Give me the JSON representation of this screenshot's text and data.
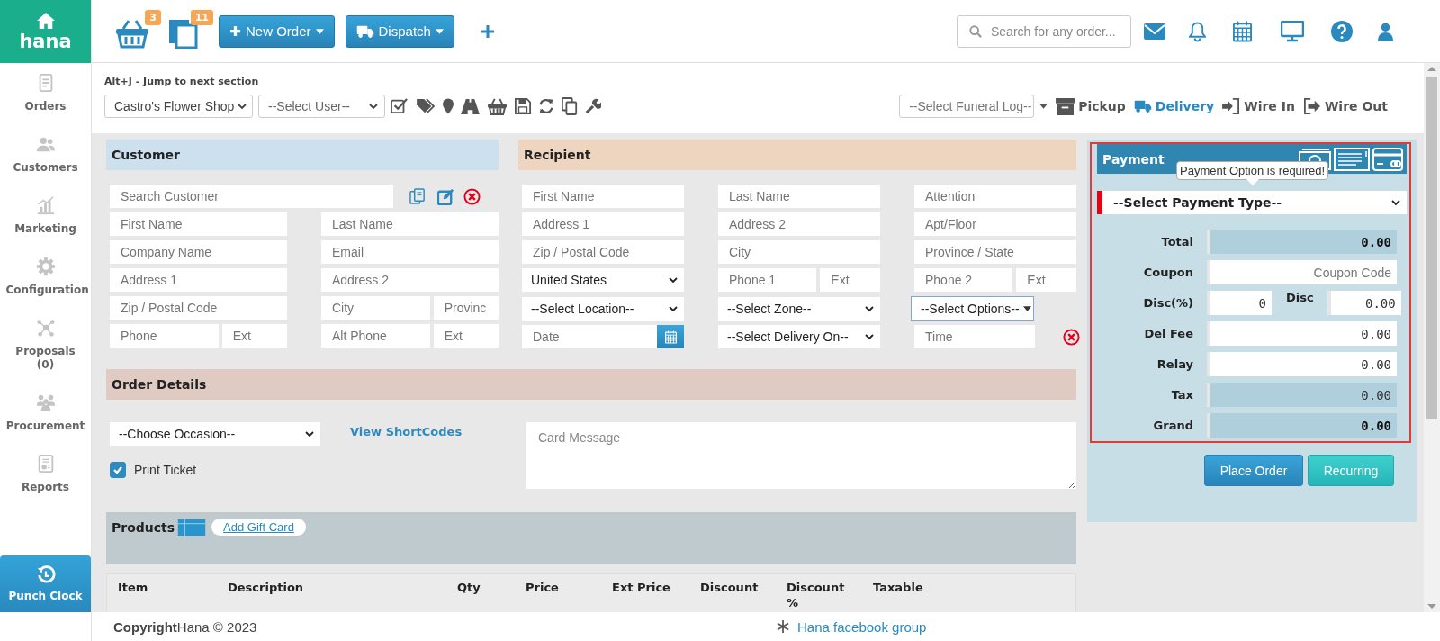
{
  "brand": {
    "name": "hana"
  },
  "sidebar": {
    "items": [
      {
        "kind": "orders",
        "label": "Orders"
      },
      {
        "kind": "customers",
        "label": "Customers"
      },
      {
        "kind": "marketing",
        "label": "Marketing"
      },
      {
        "kind": "configuration",
        "label": "Configuration"
      },
      {
        "kind": "proposals",
        "label": "Proposals (0)"
      },
      {
        "kind": "procurement",
        "label": "Procurement"
      },
      {
        "kind": "reports",
        "label": "Reports"
      }
    ],
    "punch_clock": {
      "label": "Punch Clock"
    }
  },
  "topbar": {
    "counters": [
      {
        "kind": "basket",
        "count": "3"
      },
      {
        "kind": "copies",
        "count": "11"
      }
    ],
    "buttons": [
      {
        "kind": "new_order",
        "label": "New Order"
      },
      {
        "kind": "dispatch",
        "label": "Dispatch"
      }
    ],
    "search": {
      "placeholder": "Search for any order..."
    }
  },
  "hint": "Alt+J - Jump to next section",
  "toolbar": {
    "shop": "Castro's Flower Shop",
    "user": "--Select User--",
    "funeral_log": "--Select Funeral Log--",
    "order_types": [
      {
        "kind": "pickup",
        "label": "Pickup",
        "selected": false
      },
      {
        "kind": "delivery",
        "label": "Delivery",
        "selected": true
      },
      {
        "kind": "wire_in",
        "label": "Wire In",
        "selected": false
      },
      {
        "kind": "wire_out",
        "label": "Wire Out",
        "selected": false
      }
    ]
  },
  "customer": {
    "title": "Customer",
    "search": {
      "placeholder": "Search Customer"
    },
    "rows": [
      {
        "left": [
          {
            "placeholder": "First Name"
          }
        ],
        "right": [
          {
            "placeholder": "Last Name"
          }
        ]
      },
      {
        "left": [
          {
            "placeholder": "Company Name"
          }
        ],
        "right": [
          {
            "placeholder": "Email"
          }
        ]
      },
      {
        "left": [
          {
            "placeholder": "Address 1"
          }
        ],
        "right": [
          {
            "placeholder": "Address 2"
          }
        ]
      },
      {
        "left": [
          {
            "placeholder": "Zip / Postal Code"
          }
        ],
        "right": [
          {
            "placeholder": "City"
          },
          {
            "placeholder": "Provinc"
          }
        ]
      },
      {
        "left": [
          {
            "placeholder": "Phone"
          },
          {
            "placeholder": "Ext"
          }
        ],
        "right": [
          {
            "placeholder": "Alt Phone"
          },
          {
            "placeholder": "Ext"
          }
        ]
      }
    ]
  },
  "recipient": {
    "title": "Recipient",
    "rows": [
      [
        [
          {
            "kind": "input",
            "placeholder": "First Name"
          }
        ],
        [
          {
            "kind": "input",
            "placeholder": "Last Name"
          }
        ],
        [
          {
            "kind": "input",
            "placeholder": "Attention"
          }
        ]
      ],
      [
        [
          {
            "kind": "input",
            "placeholder": "Address 1"
          }
        ],
        [
          {
            "kind": "input",
            "placeholder": "Address 2"
          }
        ],
        [
          {
            "kind": "input",
            "placeholder": "Apt/Floor"
          }
        ]
      ],
      [
        [
          {
            "kind": "input",
            "placeholder": "Zip / Postal Code"
          }
        ],
        [
          {
            "kind": "input",
            "placeholder": "City"
          }
        ],
        [
          {
            "kind": "input",
            "placeholder": "Province / State"
          }
        ]
      ],
      [
        [
          {
            "kind": "select",
            "value": "United States"
          }
        ],
        [
          {
            "kind": "input",
            "placeholder": "Phone 1"
          },
          {
            "kind": "input",
            "placeholder": "Ext"
          }
        ],
        [
          {
            "kind": "input",
            "placeholder": "Phone 2"
          },
          {
            "kind": "input",
            "placeholder": "Ext"
          }
        ]
      ],
      [
        [
          {
            "kind": "select",
            "value": "--Select Location--"
          }
        ],
        [
          {
            "kind": "select",
            "value": "--Select Zone--"
          }
        ],
        [
          {
            "kind": "dropdown",
            "value": "--Select Options--"
          }
        ]
      ],
      [
        [
          {
            "kind": "date",
            "placeholder": "Date"
          }
        ],
        [
          {
            "kind": "select",
            "value": "--Select Delivery On--"
          }
        ],
        [
          {
            "kind": "time",
            "placeholder": "Time"
          }
        ]
      ]
    ]
  },
  "order_details": {
    "title": "Order Details",
    "occasion": "--Choose Occasion--",
    "shortcodes_link": "View ShortCodes",
    "print_ticket": {
      "label": "Print Ticket",
      "checked": true
    },
    "card_message": {
      "placeholder": "Card Message"
    }
  },
  "products": {
    "title": "Products",
    "gift_card_link": "Add Gift Card",
    "columns": [
      "Item",
      "Description",
      "Qty",
      "Price",
      "Ext Price",
      "Discount",
      "Discount %",
      "Taxable"
    ]
  },
  "payment": {
    "title": "Payment",
    "highlighted": true,
    "tooltip": "Payment Option is required!",
    "type_select": {
      "value": "--Select Payment Type--",
      "invalid": true
    },
    "rows": [
      {
        "kind": "total",
        "label": "Total",
        "value": "0.00"
      },
      {
        "kind": "input",
        "label": "Coupon",
        "placeholder": "Coupon Code"
      },
      {
        "kind": "pair",
        "label": "Disc(%)",
        "value": "0",
        "label_2": "Disc",
        "value_2": "0.00"
      },
      {
        "kind": "input",
        "label": "Del Fee",
        "value": "0.00"
      },
      {
        "kind": "input",
        "label": "Relay",
        "value": "0.00"
      },
      {
        "kind": "readonly",
        "label": "Tax",
        "value": "0.00"
      },
      {
        "kind": "total",
        "label": "Grand",
        "value": "0.00"
      }
    ],
    "buttons": [
      {
        "kind": "primary",
        "label": "Place Order"
      },
      {
        "kind": "secondary",
        "label": "Recurring"
      }
    ]
  },
  "footer": {
    "copyright": "**Copyright**Hana © 2023",
    "link": "Hana facebook group"
  }
}
